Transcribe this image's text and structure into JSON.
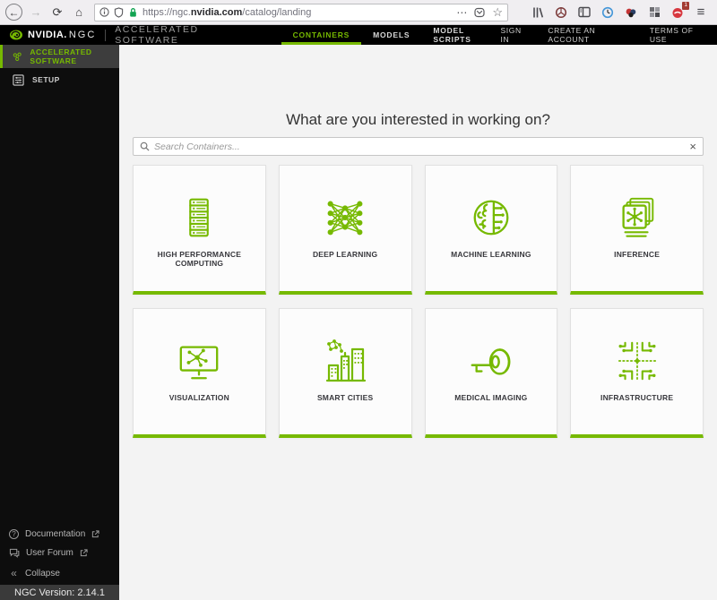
{
  "browser": {
    "url_prefix": "https://ngc.",
    "url_domain": "nvidia.com",
    "url_path": "/catalog/landing",
    "ext_badge": "1"
  },
  "icons": {
    "back": "←",
    "forward": "→",
    "reload": "⟳",
    "home": "⌂",
    "page_actions": "⋯",
    "bookmark_star": "☆",
    "menu": "≡",
    "collapse": "«",
    "close": "×"
  },
  "header": {
    "brand": "NVIDIA.",
    "brand_suffix": "NGC",
    "app_title": "ACCELERATED SOFTWARE",
    "nav": [
      {
        "label": "CONTAINERS",
        "active": true
      },
      {
        "label": "MODELS",
        "active": false
      },
      {
        "label": "MODEL SCRIPTS",
        "active": false
      }
    ],
    "right_links": [
      {
        "label": "SIGN IN"
      },
      {
        "label": "CREATE AN ACCOUNT"
      },
      {
        "label": "TERMS OF USE"
      }
    ]
  },
  "sidebar": {
    "items": [
      {
        "label": "ACCELERATED SOFTWARE",
        "active": true
      },
      {
        "label": "SETUP",
        "active": false
      }
    ],
    "footer": {
      "documentation": "Documentation",
      "user_forum": "User Forum",
      "collapse": "Collapse"
    },
    "version": "NGC Version: 2.14.1"
  },
  "main": {
    "heading": "What are you interested in working on?",
    "search_placeholder": "Search Containers...",
    "cards": [
      {
        "label": "HIGH PERFORMANCE COMPUTING"
      },
      {
        "label": "DEEP LEARNING"
      },
      {
        "label": "MACHINE LEARNING"
      },
      {
        "label": "INFERENCE"
      },
      {
        "label": "VISUALIZATION"
      },
      {
        "label": "SMART CITIES"
      },
      {
        "label": "MEDICAL IMAGING"
      },
      {
        "label": "INFRASTRUCTURE"
      }
    ]
  },
  "colors": {
    "accent": "#76b900",
    "header_bg": "#000000",
    "sidebar_bg": "#0d0d0d"
  }
}
